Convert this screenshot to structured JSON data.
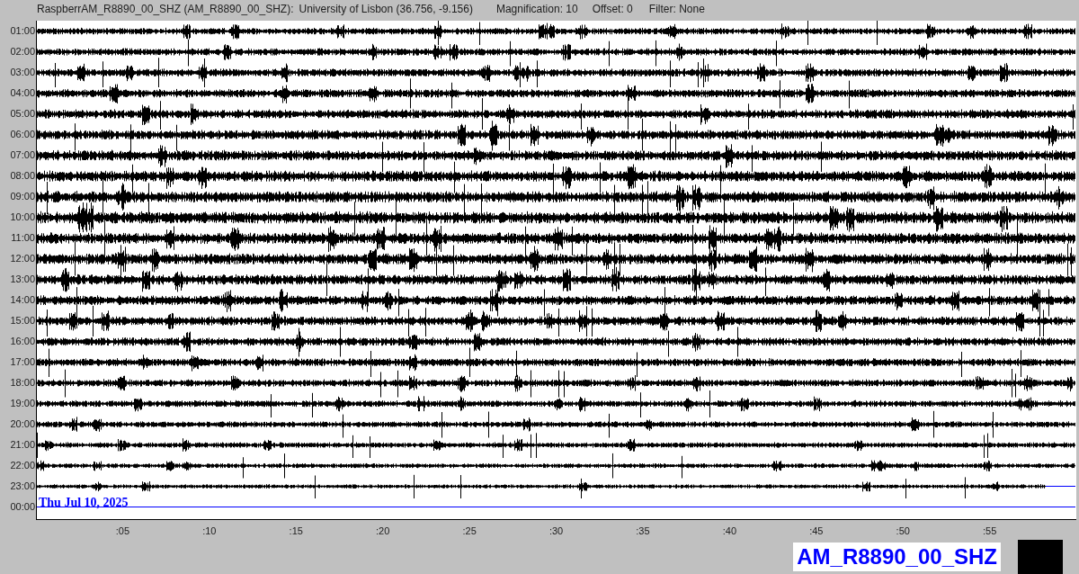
{
  "header": {
    "station": "RaspberrAM_R8890_00_SHZ (AM_R8890_00_SHZ):",
    "location": "University of Lisbon (36.756, -9.156)",
    "magnification": "Magnification: 10",
    "offset": "Offset: 0",
    "filter": "Filter: None"
  },
  "rows": [
    {
      "label": "01:00",
      "kind": "trace"
    },
    {
      "label": "02:00",
      "kind": "trace"
    },
    {
      "label": "03:00",
      "kind": "trace"
    },
    {
      "label": "04:00",
      "kind": "trace"
    },
    {
      "label": "05:00",
      "kind": "trace"
    },
    {
      "label": "06:00",
      "kind": "trace"
    },
    {
      "label": "07:00",
      "kind": "trace"
    },
    {
      "label": "08:00",
      "kind": "trace"
    },
    {
      "label": "09:00",
      "kind": "trace"
    },
    {
      "label": "10:00",
      "kind": "trace"
    },
    {
      "label": "11:00",
      "kind": "trace"
    },
    {
      "label": "12:00",
      "kind": "trace"
    },
    {
      "label": "13:00",
      "kind": "trace"
    },
    {
      "label": "14:00",
      "kind": "trace"
    },
    {
      "label": "15:00",
      "kind": "trace"
    },
    {
      "label": "16:00",
      "kind": "trace"
    },
    {
      "label": "17:00",
      "kind": "trace"
    },
    {
      "label": "18:00",
      "kind": "trace"
    },
    {
      "label": "19:00",
      "kind": "trace"
    },
    {
      "label": "20:00",
      "kind": "trace"
    },
    {
      "label": "21:00",
      "kind": "trace"
    },
    {
      "label": "22:00",
      "kind": "trace"
    },
    {
      "label": "23:00",
      "kind": "partial"
    },
    {
      "label": "00:00",
      "kind": "empty"
    }
  ],
  "date": "Thu Jul 10, 2025",
  "x_ticks": [
    ":05",
    ":10",
    ":15",
    ":20",
    ":25",
    ":30",
    ":35",
    ":40",
    ":45",
    ":50",
    ":55"
  ],
  "station_label": "AM_R8890_00_SHZ"
}
